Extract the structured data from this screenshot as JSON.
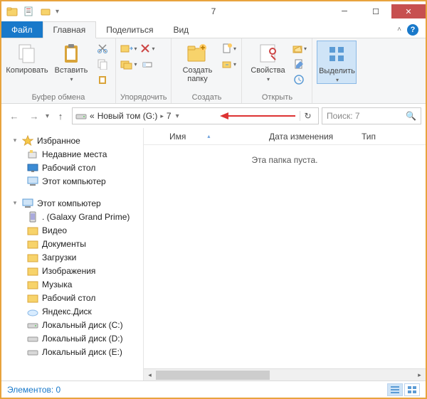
{
  "title": "7",
  "tabs": {
    "file": "Файл",
    "home": "Главная",
    "share": "Поделиться",
    "view": "Вид"
  },
  "ribbon": {
    "copy": "Копировать",
    "paste": "Вставить",
    "clipboard_group": "Буфер обмена",
    "organize_group": "Упорядочить",
    "new_folder": "Создать папку",
    "new_group": "Создать",
    "properties": "Свойства",
    "open_group": "Открыть",
    "select": "Выделить"
  },
  "breadcrumb": {
    "prefix": "«",
    "vol": "Новый том (G:)",
    "folder": "7"
  },
  "search": {
    "placeholder": "Поиск: 7"
  },
  "columns": {
    "name": "Имя",
    "date": "Дата изменения",
    "type": "Тип"
  },
  "empty_msg": "Эта папка пуста.",
  "tree": {
    "fav": "Избранное",
    "recent": "Недавние места",
    "desktop": "Рабочий стол",
    "thispc": "Этот компьютер",
    "thispc2": "Этот компьютер",
    "galaxy": ". (Galaxy Grand Prime)",
    "video": "Видео",
    "docs": "Документы",
    "downloads": "Загрузки",
    "pictures": "Изображения",
    "music": "Музыка",
    "desktop2": "Рабочий стол",
    "yadisk": "Яндекс.Диск",
    "diskc": "Локальный диск (C:)",
    "diskd": "Локальный диск (D:)",
    "diske": "Локальный диск (E:)"
  },
  "status": {
    "items": "Элементов: 0"
  }
}
